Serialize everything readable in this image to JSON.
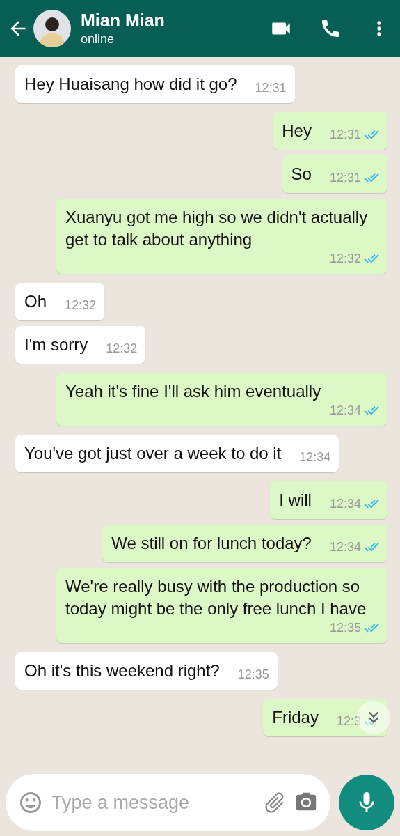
{
  "header": {
    "name": "Mian Mian",
    "status": "online"
  },
  "messages": [
    {
      "kind": "received",
      "text": "Hey Huaisang how did it go?",
      "time": "12:31"
    },
    {
      "kind": "sent",
      "text": "Hey",
      "time": "12:31",
      "read": true
    },
    {
      "kind": "sent",
      "text": "So",
      "time": "12:31",
      "read": true
    },
    {
      "kind": "sent",
      "text": "Xuanyu got me high so we didn't actually get to talk about anything",
      "time": "12:32",
      "read": true
    },
    {
      "kind": "received",
      "text": "Oh",
      "time": "12:32"
    },
    {
      "kind": "received",
      "text": "I'm sorry",
      "time": "12:32"
    },
    {
      "kind": "sent",
      "text": "Yeah it's fine I'll ask him eventually",
      "time": "12:34",
      "read": true
    },
    {
      "kind": "received",
      "text": "You've got just over a week to do it",
      "time": "12:34"
    },
    {
      "kind": "sent",
      "text": "I will",
      "time": "12:34",
      "read": true
    },
    {
      "kind": "sent",
      "text": "We still on for lunch today?",
      "time": "12:34",
      "read": true
    },
    {
      "kind": "sent",
      "text": "We're really busy with the production so today might be the only free lunch I have",
      "time": "12:35",
      "read": true
    },
    {
      "kind": "received",
      "text": "Oh it's this weekend right?",
      "time": "12:35"
    },
    {
      "kind": "sent",
      "text": "Friday",
      "time": "12:3",
      "read": true
    }
  ],
  "composer": {
    "placeholder": "Type a message"
  }
}
